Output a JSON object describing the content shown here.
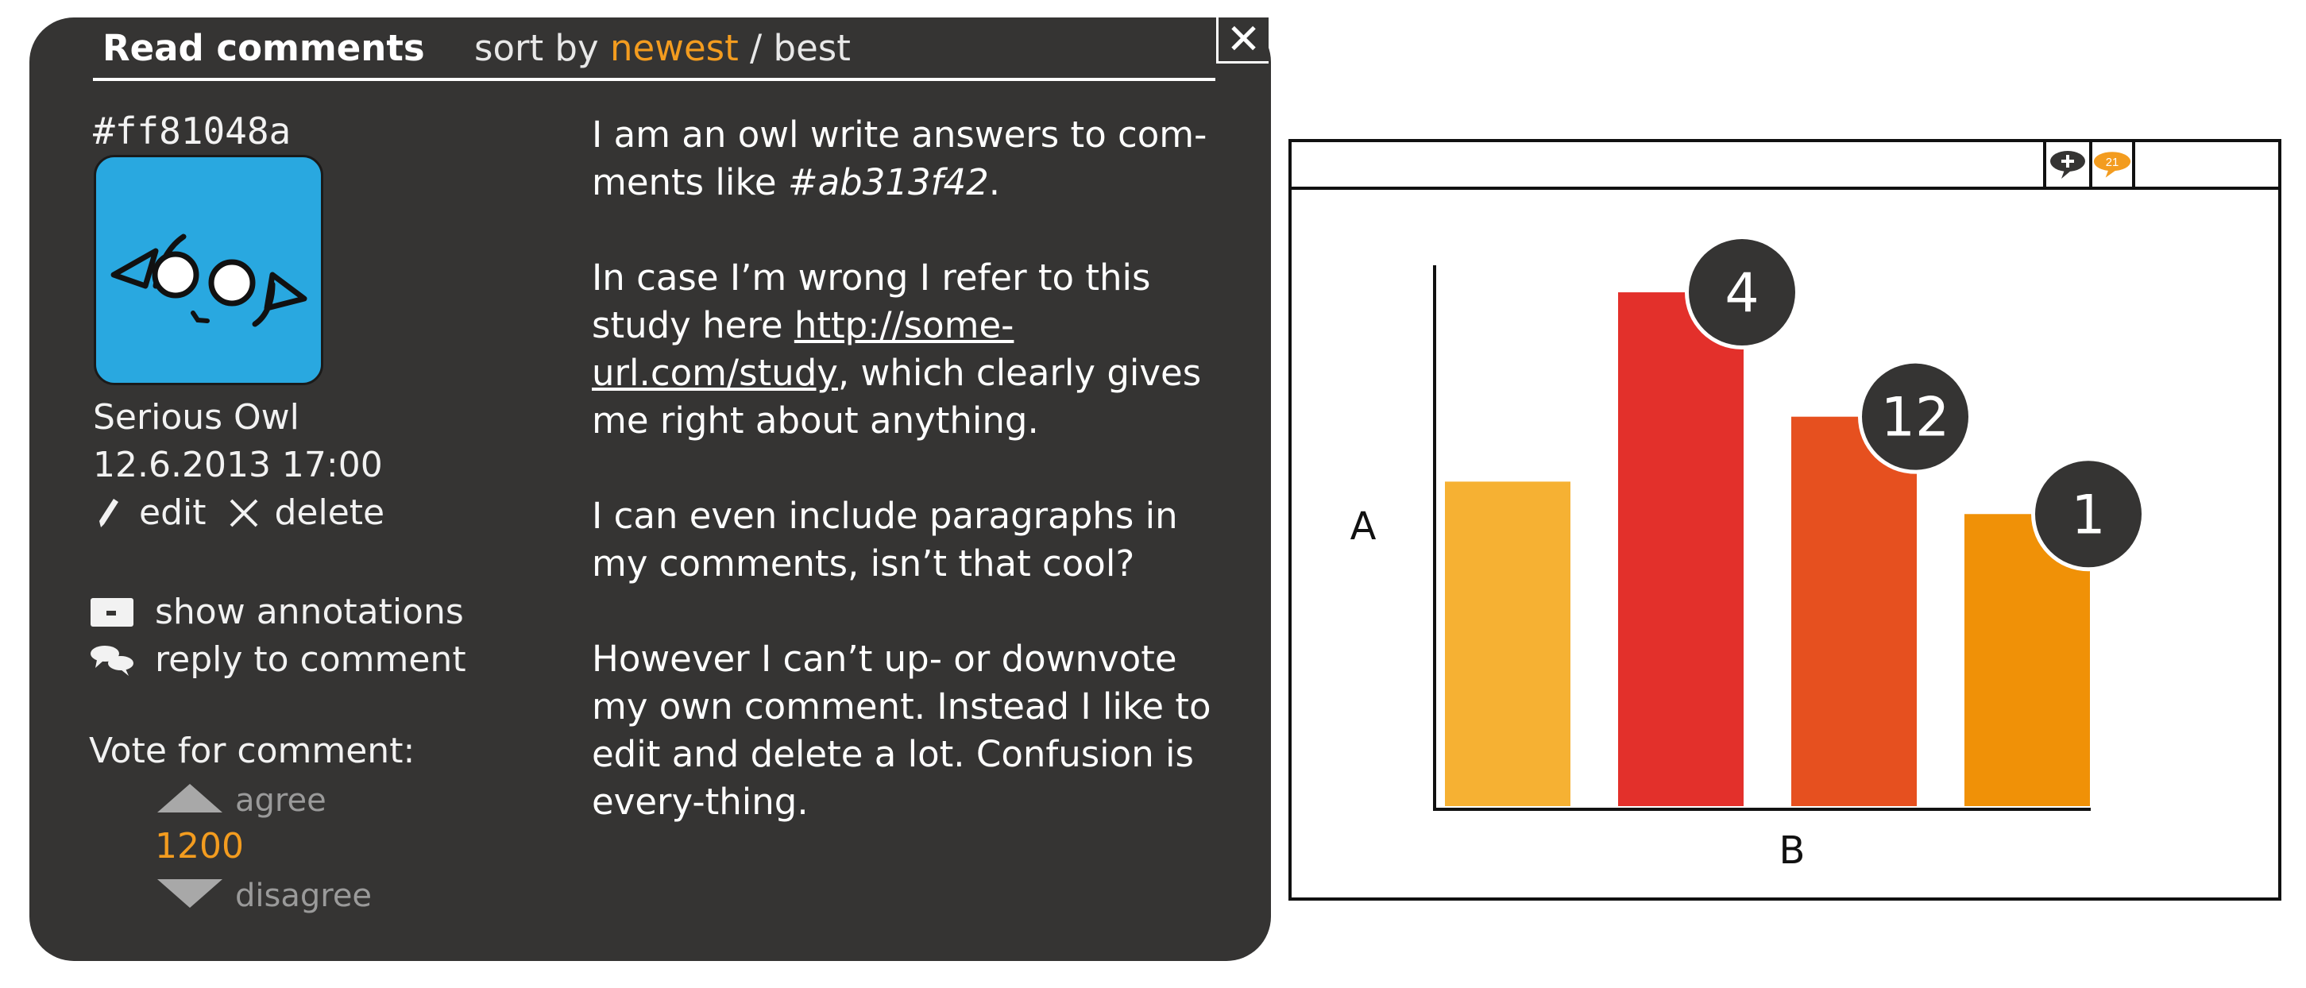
{
  "header": {
    "title": "Read comments",
    "sort_prefix": "sort by",
    "sort_newest": "newest",
    "sort_sep": " / ",
    "sort_best": "best",
    "close_icon": "close-icon"
  },
  "comment": {
    "id": "#ff81048a",
    "author": "Serious Owl",
    "timestamp": "12.6.2013 17:00",
    "edit_label": "edit",
    "delete_label": "delete",
    "show_annotations_label": "show annotations",
    "reply_label": "reply to comment",
    "vote_title": "Vote for comment:",
    "agree_label": "agree",
    "vote_count": "1200",
    "disagree_label": "disagree",
    "body": {
      "p1_text": "I am an owl write answers to com-ments like ",
      "p1_ref": "#ab313f42",
      "p1_end": ".",
      "p2_text": "In case I’m wrong I refer to this study here ",
      "p2_link": "http://some-url.com/study",
      "p2_end": ", which clearly gives me right about anything.",
      "p3": "I can even include paragraphs in my comments, isn’t that cool?",
      "p4": "However I can’t up- or downvote my own comment. Instead I like to edit and delete a lot. Confusion is every-thing."
    }
  },
  "doc": {
    "toolbar": {
      "add_comment_icon": "add-comment-icon",
      "comment_count": "21",
      "comment_count_icon": "comment-count-icon"
    }
  },
  "chart_data": {
    "type": "bar",
    "xlabel": "B",
    "ylabel": "A",
    "categories": [
      "",
      "",
      "",
      ""
    ],
    "values": [
      60,
      95,
      72,
      54
    ],
    "colors": [
      "#f6b133",
      "#e3302b",
      "#e6501f",
      "#f09107"
    ],
    "annotations": [
      null,
      "4",
      "12",
      "1"
    ],
    "ylim": [
      0,
      100
    ]
  },
  "colors": {
    "panel": "#353433",
    "accent": "#f39c1f",
    "avatar": "#29a8e0"
  }
}
